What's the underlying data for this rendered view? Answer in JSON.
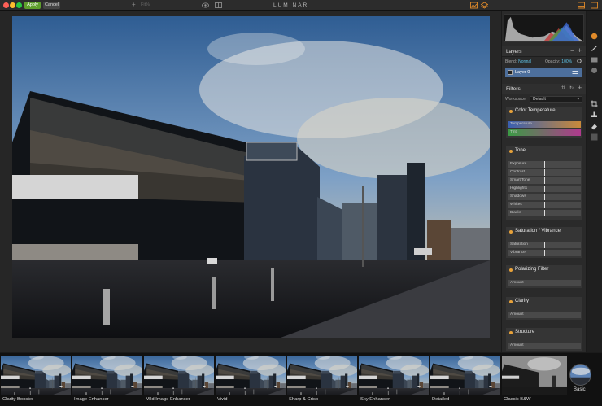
{
  "titlebar": {
    "apply_label": "Apply",
    "cancel_label": "Cancel",
    "zoom_plus": "+",
    "zoom_value": "Fit%",
    "app_title": "LUMINAR"
  },
  "layers": {
    "title": "Layers",
    "blend_label": "Blend:",
    "blend_value": "Normal",
    "opacity_label": "Opacity:",
    "opacity_value": "100%",
    "layer_name": "Layer 0"
  },
  "filters": {
    "title": "Filters",
    "workspace_label": "Workspace:",
    "workspace_value": "Default",
    "cards": [
      {
        "title": "Color Temperature",
        "sliders": [
          "Temperature",
          "Tint"
        ]
      },
      {
        "title": "Tone",
        "sliders": [
          "Exposure",
          "Contrast",
          "Smart Tone",
          "Highlights",
          "Shadows",
          "Whites",
          "Blacks"
        ]
      },
      {
        "title": "Saturation / Vibrance",
        "sliders": [
          "Saturation",
          "Vibrance"
        ]
      },
      {
        "title": "Polarizing Filter",
        "sliders": [
          "Amount"
        ]
      },
      {
        "title": "Clarity",
        "sliders": [
          "Amount"
        ]
      },
      {
        "title": "Structure",
        "sliders": [
          "Amount"
        ]
      }
    ]
  },
  "presets": {
    "items": [
      "Clarity Booster",
      "Image Enhancer",
      "Mild Image Enhancer",
      "Vivid",
      "Sharp & Crisp",
      "Sky Enhancer",
      "Detailed",
      "Classic B&W"
    ],
    "category_label": "Basic"
  },
  "icons": {
    "eye": "eye-icon",
    "compare": "compare-icon",
    "histogram": "histogram-icon",
    "brush": "brush-icon",
    "crop": "crop-icon",
    "stamp": "stamp-icon",
    "eraser": "eraser-icon"
  },
  "colors": {
    "accent_green": "#5f9e2c",
    "layer_selected": "#4d6f9c",
    "filter_dot": "#e8a23a",
    "blue_text": "#5ec3e8"
  }
}
